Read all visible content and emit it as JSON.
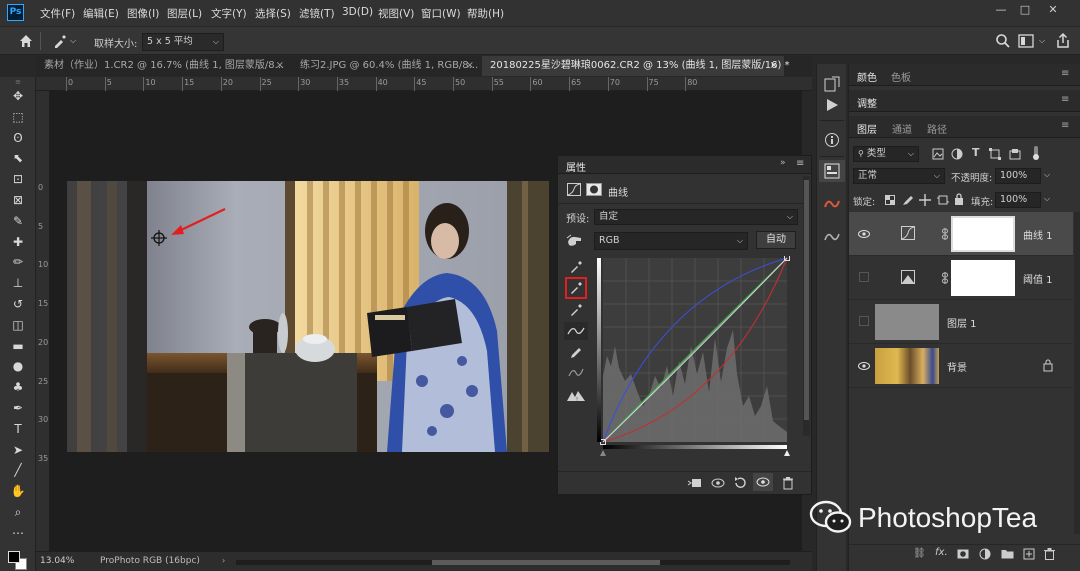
{
  "app": {
    "logo": "Ps"
  },
  "menu": [
    "文件(F)",
    "编辑(E)",
    "图像(I)",
    "图层(L)",
    "文字(Y)",
    "选择(S)",
    "滤镜(T)",
    "3D(D)",
    "视图(V)",
    "窗口(W)",
    "帮助(H)"
  ],
  "window_controls": [
    "—",
    "□",
    "✕"
  ],
  "options_bar": {
    "sample_size_label": "取样大小:",
    "sample_size_value": "5 x 5 平均"
  },
  "tabs": [
    {
      "label": "素材（作业）1.CR2 @ 16.7% (曲线 1, 图层蒙版/8...",
      "close": "×"
    },
    {
      "label": "练习2.JPG @ 60.4% (曲线 1, RGB/8...",
      "close": "×"
    },
    {
      "label": "20180225星沙碧琳琅0062.CR2 @ 13% (曲线 1, 图层蒙版/16) *",
      "close": "×"
    }
  ],
  "ruler_top_ticks": [
    "0",
    "5",
    "10",
    "15",
    "20",
    "25",
    "30",
    "35",
    "40",
    "45",
    "50",
    "55",
    "60",
    "65",
    "70",
    "75",
    "80"
  ],
  "ruler_left_ticks": [
    "0",
    "5",
    "10",
    "15",
    "20",
    "25",
    "30",
    "35"
  ],
  "status": {
    "zoom": "13.04%",
    "profile": "ProPhoto RGB (16bpc)"
  },
  "properties": {
    "title": "属性",
    "panel_type": "曲线",
    "preset_label": "预设:",
    "preset_value": "自定",
    "channel": "RGB",
    "auto_label": "自动"
  },
  "right_panel": {
    "tabs_top": [
      "颜色",
      "色板"
    ],
    "adjust_tab": "调整",
    "layer_tabs": [
      "图层",
      "通道",
      "路径"
    ],
    "filter_kind": "类型",
    "blend_mode": "正常",
    "opacity_label": "不透明度:",
    "opacity_value": "100%",
    "lock_label": "锁定:",
    "fill_label": "填充:",
    "fill_value": "100%",
    "layers": [
      {
        "name": "曲线 1",
        "visible": true,
        "selected": true,
        "type": "adjustment-curves"
      },
      {
        "name": "阈值 1",
        "visible": false,
        "selected": false,
        "type": "adjustment-threshold"
      },
      {
        "name": "图层 1",
        "visible": false,
        "selected": false,
        "type": "pixel-gray"
      },
      {
        "name": "背景",
        "visible": true,
        "selected": false,
        "type": "background"
      }
    ]
  },
  "watermark": "PhotoshopTea",
  "colors": {
    "accent_red": "#e02020",
    "curve_blue": "#3a4fd8",
    "curve_green": "#3fae4a",
    "curve_red": "#c03030"
  }
}
